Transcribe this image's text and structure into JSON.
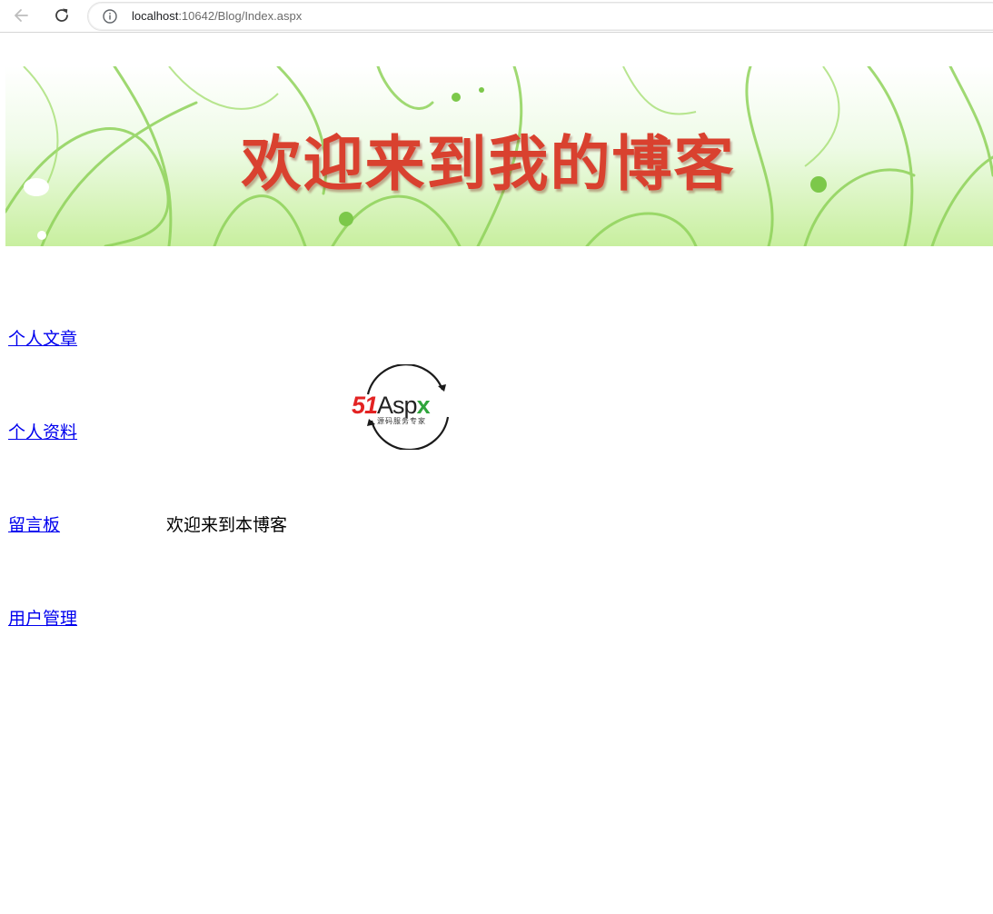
{
  "browser": {
    "url_host": "localhost",
    "url_rest": ":10642/Blog/Index.aspx",
    "icons": {
      "back": "back-arrow-icon",
      "reload": "reload-icon",
      "info": "info-icon"
    }
  },
  "banner": {
    "title": "欢迎来到我的博客",
    "title_color": "#d9412f"
  },
  "sidebar": {
    "items": [
      {
        "label": "个人文章"
      },
      {
        "label": "个人资料"
      },
      {
        "label": "留言板"
      },
      {
        "label": "用户管理"
      }
    ],
    "link_color": "#0000ee"
  },
  "logo": {
    "number": "51",
    "asp": "Asp",
    "x": "x",
    "tagline": "源码服务专家"
  },
  "main": {
    "welcome_text": "欢迎来到本博客"
  }
}
